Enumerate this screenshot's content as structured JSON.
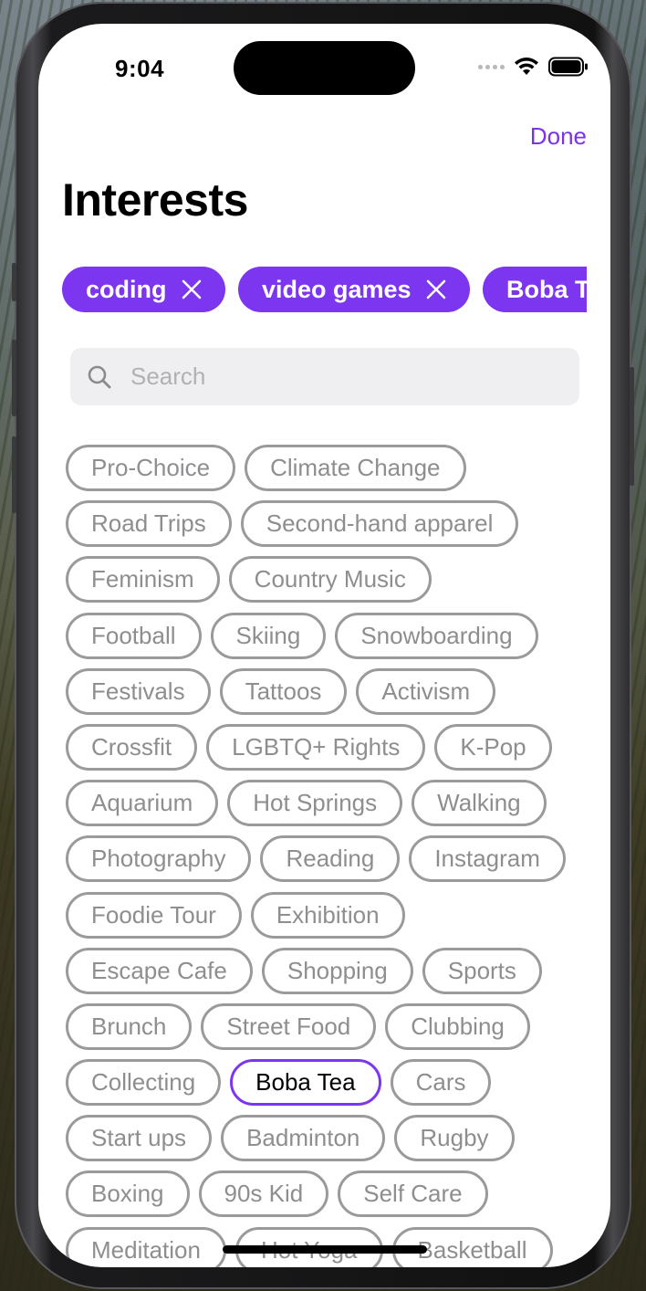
{
  "status": {
    "time": "9:04"
  },
  "header": {
    "done_label": "Done",
    "title": "Interests"
  },
  "selected": [
    {
      "label": "coding"
    },
    {
      "label": "video games"
    },
    {
      "label": "Boba Tea"
    }
  ],
  "search": {
    "placeholder": "Search",
    "value": ""
  },
  "colors": {
    "accent": "#7c36ef",
    "tag_border": "#9a9a9c",
    "tag_text": "#8e8e90"
  },
  "tags": [
    [
      "Pro-Choice",
      "Climate Change"
    ],
    [
      "Road Trips",
      "Second-hand apparel"
    ],
    [
      "Feminism",
      "Country Music"
    ],
    [
      "Football",
      "Skiing",
      "Snowboarding"
    ],
    [
      "Festivals",
      "Tattoos",
      "Activism"
    ],
    [
      "Crossfit",
      "LGBTQ+ Rights",
      "K-Pop"
    ],
    [
      "Aquarium",
      "Hot Springs",
      "Walking"
    ],
    [
      "Photography",
      "Reading",
      "Instagram"
    ],
    [
      "Foodie Tour",
      "Exhibition"
    ],
    [
      "Escape Cafe",
      "Shopping",
      "Sports"
    ],
    [
      "Brunch",
      "Street Food",
      "Clubbing"
    ],
    [
      "Collecting",
      "Boba Tea",
      "Cars"
    ],
    [
      "Start ups",
      "Badminton",
      "Rugby"
    ],
    [
      "Boxing",
      "90s Kid",
      "Self Care"
    ],
    [
      "Meditation",
      "Hot Yoga",
      "Basketball"
    ]
  ],
  "active_tag": "Boba Tea"
}
